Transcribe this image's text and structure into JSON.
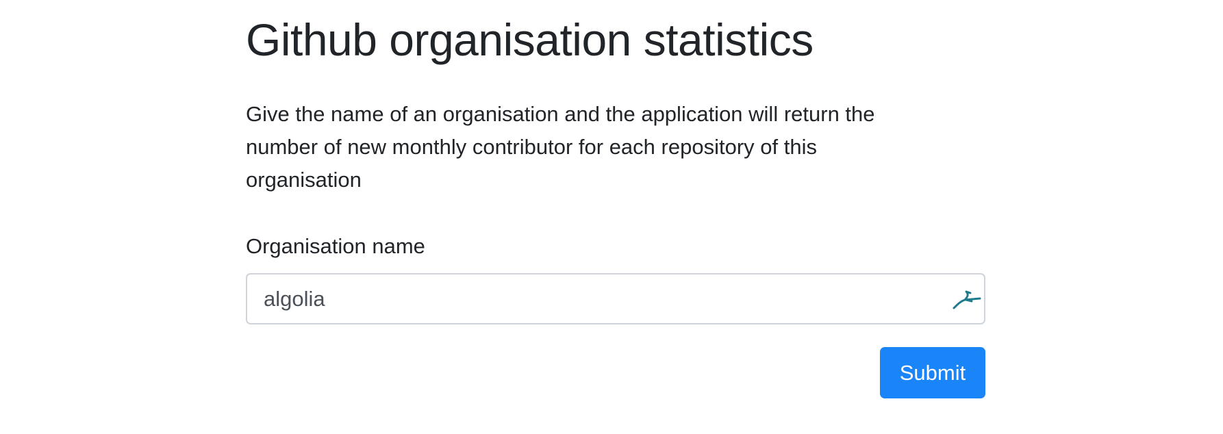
{
  "page": {
    "title": "Github organisation statistics",
    "intro": "Give the name of an organisation and the application will return the number of new monthly contributor for each repository of this organisation"
  },
  "form": {
    "label": "Organisation name",
    "input_value": "algolia",
    "submit_label": "Submit",
    "extension_icon": "leaping-deer-icon"
  },
  "colors": {
    "primary": "#1a85f8",
    "text": "#212529",
    "input_border": "#ced4da",
    "input_text": "#495057",
    "icon": "#1f7a8c"
  }
}
